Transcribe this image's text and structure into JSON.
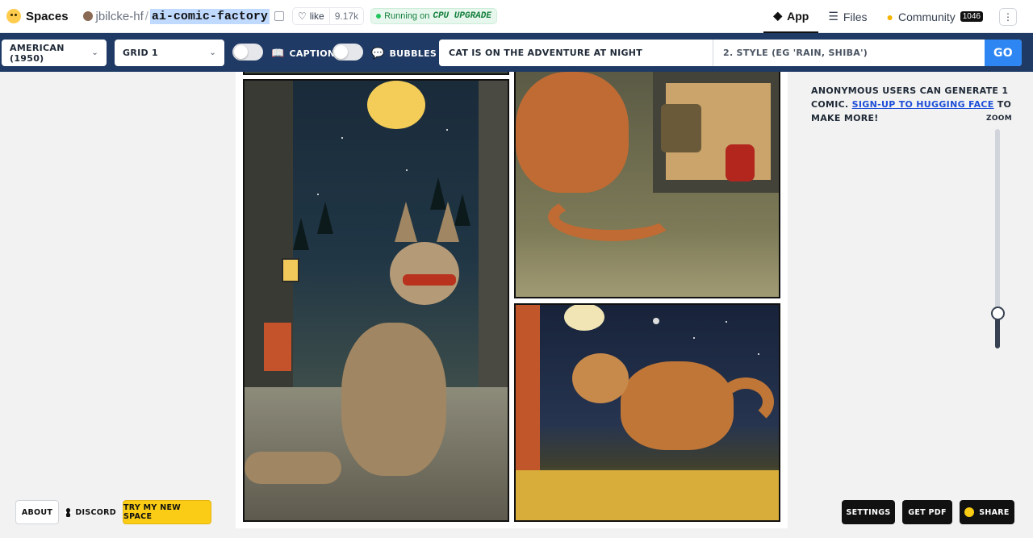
{
  "header": {
    "brand": "Spaces",
    "owner": "jbilcke-hf",
    "separator": "/",
    "repo": "ai-comic-factory",
    "like_label": "like",
    "like_count": "9.17k",
    "status_prefix": "Running on",
    "status_hardware": "CPU UPGRADE",
    "tabs": [
      {
        "label": "App",
        "active": true
      },
      {
        "label": "Files",
        "active": false
      },
      {
        "label": "Community",
        "active": false,
        "badge": "1046"
      }
    ]
  },
  "toolbar": {
    "style_select": "American (1950)",
    "layout_select": "Grid 1",
    "captions_label": "Captions",
    "bubbles_label": "Bubbles",
    "prompt_value": "cat is on the adventure at night",
    "style_placeholder": "2. Style (eg 'rain, shiba')",
    "go_label": "GO"
  },
  "sidebar": {
    "notice_text": "Anonymous users can generate 1 comic.",
    "notice_link": "Sign-up to Hugging Face",
    "notice_suffix": "to make more!",
    "zoom_label": "ZOOM",
    "zoom_level": 0.16
  },
  "footer": {
    "about": "About",
    "discord": "Discord",
    "try_space": "Try my new space",
    "settings": "Settings",
    "get_pdf": "Get PDF",
    "share": "Share"
  },
  "colors": {
    "toolbar_bg": "#1f3a64",
    "go_button": "#2e86f2",
    "accent_yellow": "#facc15",
    "status_green": "#15803d"
  }
}
